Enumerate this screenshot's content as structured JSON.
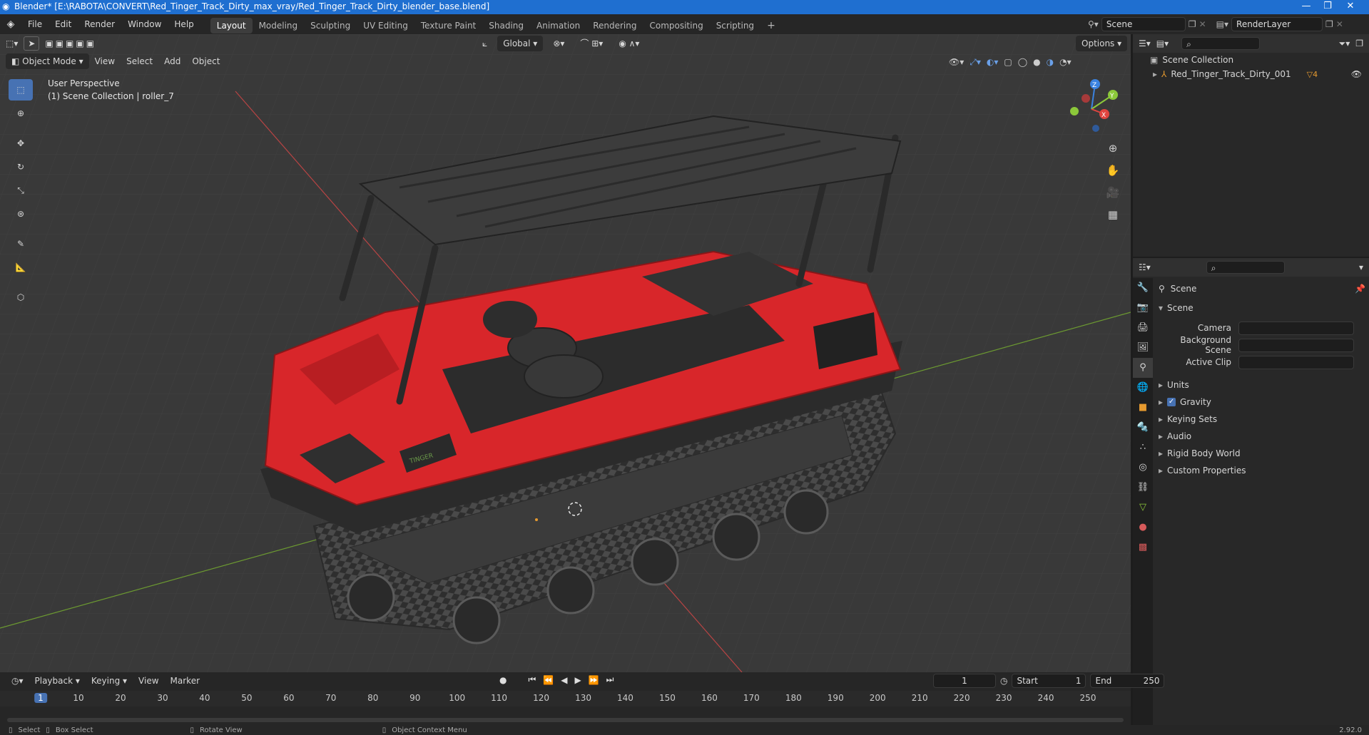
{
  "window": {
    "title": "Blender* [E:\\RABOTA\\CONVERT\\Red_Tinger_Track_Dirty_max_vray/Red_Tinger_Track_Dirty_blender_base.blend]",
    "controls": {
      "minimize": "—",
      "restore": "❐",
      "close": "✕"
    }
  },
  "topbar": {
    "menus": [
      "File",
      "Edit",
      "Render",
      "Window",
      "Help"
    ],
    "workspaces": [
      "Layout",
      "Modeling",
      "Sculpting",
      "UV Editing",
      "Texture Paint",
      "Shading",
      "Animation",
      "Rendering",
      "Compositing",
      "Scripting"
    ],
    "active_workspace": "Layout",
    "add_workspace": "+",
    "scene_label": "Scene",
    "view_layer_label": "RenderLayer"
  },
  "viewport": {
    "mode": "Object Mode",
    "menus": [
      "View",
      "Select",
      "Add",
      "Object"
    ],
    "transform_orientation": "Global",
    "options_label": "Options",
    "overlay_line1": "User Perspective",
    "overlay_line2": "(1) Scene Collection | roller_7",
    "gizmo_axes": {
      "z": "Z",
      "y": "Y",
      "x": "X"
    },
    "model_badge": "TINGER"
  },
  "outliner": {
    "search_placeholder": "",
    "root": "Scene Collection",
    "items": [
      {
        "name": "Red_Tinger_Track_Dirty_001",
        "badge": "4"
      }
    ]
  },
  "properties": {
    "context_title": "Scene",
    "section_title": "Scene",
    "rows": [
      {
        "label": "Camera",
        "value": ""
      },
      {
        "label": "Background Scene",
        "value": ""
      },
      {
        "label": "Active Clip",
        "value": ""
      }
    ],
    "panels": [
      {
        "label": "Units",
        "checkbox": false
      },
      {
        "label": "Gravity",
        "checkbox": true
      },
      {
        "label": "Keying Sets",
        "checkbox": false
      },
      {
        "label": "Audio",
        "checkbox": false
      },
      {
        "label": "Rigid Body World",
        "checkbox": false
      },
      {
        "label": "Custom Properties",
        "checkbox": false
      }
    ]
  },
  "timeline": {
    "menus": [
      "Playback",
      "Keying",
      "View",
      "Marker"
    ],
    "current_frame": "1",
    "start_label": "Start",
    "start_value": "1",
    "end_label": "End",
    "end_value": "250",
    "ruler": [
      "1",
      "10",
      "20",
      "30",
      "40",
      "50",
      "60",
      "70",
      "80",
      "90",
      "100",
      "110",
      "120",
      "130",
      "140",
      "150",
      "160",
      "170",
      "180",
      "190",
      "200",
      "210",
      "220",
      "230",
      "240",
      "250"
    ]
  },
  "statusbar": {
    "select": "Select",
    "box_select": "Box Select",
    "rotate_view": "Rotate View",
    "context_menu": "Object Context Menu",
    "version": "2.92.0"
  },
  "colors": {
    "accent": "#4772b3",
    "titlebar": "#1f6fd0",
    "model_red": "#d8262a",
    "x_axis": "#e0453f",
    "y_axis": "#8cc83a",
    "z_axis": "#3b83e0"
  }
}
